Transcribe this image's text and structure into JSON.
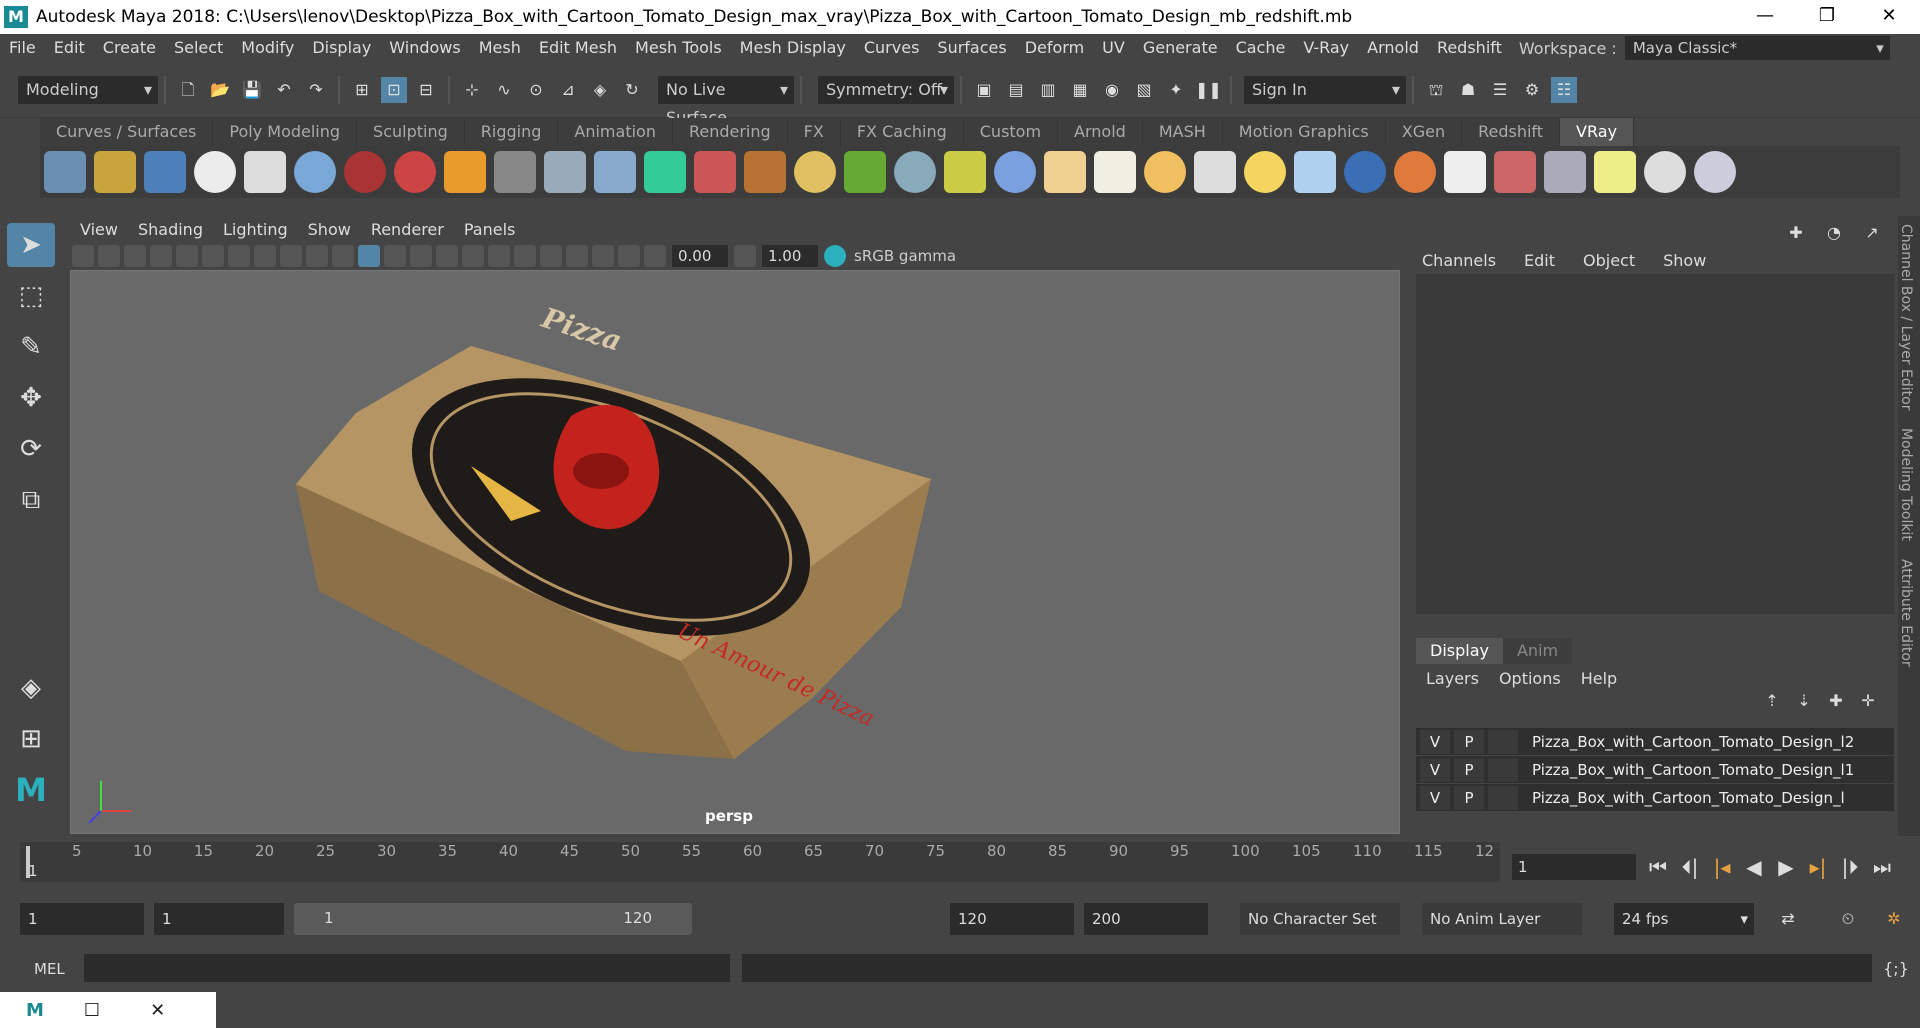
{
  "window": {
    "title": "Autodesk Maya 2018: C:\\Users\\lenov\\Desktop\\Pizza_Box_with_Cartoon_Tomato_Design_max_vray\\Pizza_Box_with_Cartoon_Tomato_Design_mb_redshift.mb",
    "logo": "M",
    "minimize": "—",
    "restore": "❐",
    "close": "✕"
  },
  "menu": [
    "File",
    "Edit",
    "Create",
    "Select",
    "Modify",
    "Display",
    "Windows",
    "Mesh",
    "Edit Mesh",
    "Mesh Tools",
    "Mesh Display",
    "Curves",
    "Surfaces",
    "Deform",
    "UV",
    "Generate",
    "Cache",
    "V-Ray",
    "Arnold",
    "Redshift"
  ],
  "workspace": {
    "label": "Workspace :",
    "value": "Maya Classic*"
  },
  "status": {
    "mode": "Modeling",
    "live_surface": "No Live Surface",
    "symmetry": "Symmetry: Off",
    "signin": "Sign In"
  },
  "shelf_tabs": [
    "Curves / Surfaces",
    "Poly Modeling",
    "Sculpting",
    "Rigging",
    "Animation",
    "Rendering",
    "FX",
    "FX Caching",
    "Custom",
    "Arnold",
    "MASH",
    "Motion Graphics",
    "XGen",
    "Redshift",
    "VRay"
  ],
  "viewport": {
    "menu": [
      "View",
      "Shading",
      "Lighting",
      "Show",
      "Renderer",
      "Panels"
    ],
    "exposure": "0.00",
    "gamma": "1.00",
    "colorspace": "sRGB gamma",
    "camera": "persp"
  },
  "model": {
    "lid_text": "Pizza",
    "lid_slogan": "Un Amour de Pizza"
  },
  "channelbox": {
    "menu": [
      "Channels",
      "Edit",
      "Object",
      "Show"
    ]
  },
  "layers": {
    "tabs": [
      "Display",
      "Anim"
    ],
    "menu": [
      "Layers",
      "Options",
      "Help"
    ],
    "items": [
      {
        "v": "V",
        "p": "P",
        "name": "Pizza_Box_with_Cartoon_Tomato_Design_l2"
      },
      {
        "v": "V",
        "p": "P",
        "name": "Pizza_Box_with_Cartoon_Tomato_Design_l1"
      },
      {
        "v": "V",
        "p": "P",
        "name": "Pizza_Box_with_Cartoon_Tomato_Design_l"
      }
    ]
  },
  "side_tabs": [
    "Channel Box / Layer Editor",
    "Modeling Toolkit",
    "Attribute Editor"
  ],
  "timeline": {
    "ticks": [
      "5",
      "10",
      "15",
      "20",
      "25",
      "30",
      "35",
      "40",
      "45",
      "50",
      "55",
      "60",
      "65",
      "70",
      "75",
      "80",
      "85",
      "90",
      "95",
      "100",
      "105",
      "110",
      "115",
      "12"
    ],
    "start_marker": "1",
    "current": "1"
  },
  "range": {
    "start": "1",
    "inner_start": "1",
    "slider_start": "1",
    "slider_end": "120",
    "end": "120",
    "max": "200",
    "character_set": "No Character Set",
    "anim_layer": "No Anim Layer",
    "fps": "24 fps"
  },
  "cmd": {
    "label": "MEL"
  }
}
